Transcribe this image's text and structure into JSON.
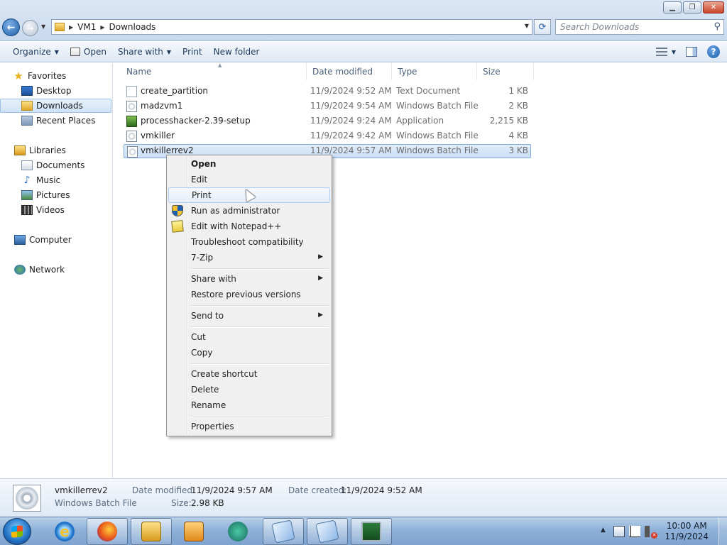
{
  "window": {
    "breadcrumb": [
      "VM1",
      "Downloads"
    ],
    "search_placeholder": "Search Downloads"
  },
  "toolbar": {
    "organize": "Organize",
    "open": "Open",
    "share_with": "Share with",
    "print": "Print",
    "new_folder": "New folder"
  },
  "sidebar": {
    "favorites": "Favorites",
    "desktop": "Desktop",
    "downloads": "Downloads",
    "recent_places": "Recent Places",
    "libraries": "Libraries",
    "documents": "Documents",
    "music": "Music",
    "pictures": "Pictures",
    "videos": "Videos",
    "computer": "Computer",
    "network": "Network"
  },
  "columns": {
    "name": "Name",
    "date_modified": "Date modified",
    "type": "Type",
    "size": "Size"
  },
  "files": [
    {
      "name": "create_partition",
      "date": "11/9/2024 9:52 AM",
      "type": "Text Document",
      "size": "1 KB",
      "icon": "text-file-icon"
    },
    {
      "name": "madzvm1",
      "date": "11/9/2024 9:54 AM",
      "type": "Windows Batch File",
      "size": "2 KB",
      "icon": "batch-file-icon"
    },
    {
      "name": "processhacker-2.39-setup",
      "date": "11/9/2024 9:24 AM",
      "type": "Application",
      "size": "2,215 KB",
      "icon": "application-icon"
    },
    {
      "name": "vmkiller",
      "date": "11/9/2024 9:42 AM",
      "type": "Windows Batch File",
      "size": "4 KB",
      "icon": "batch-file-icon"
    },
    {
      "name": "vmkillerrev2",
      "date": "11/9/2024 9:57 AM",
      "type": "Windows Batch File",
      "size": "3 KB",
      "icon": "batch-file-icon"
    }
  ],
  "context_menu": {
    "open": "Open",
    "edit": "Edit",
    "print": "Print",
    "run_as_admin": "Run as administrator",
    "edit_notepadpp": "Edit with Notepad++",
    "troubleshoot": "Troubleshoot compatibility",
    "seven_zip": "7-Zip",
    "share_with": "Share with",
    "restore_versions": "Restore previous versions",
    "send_to": "Send to",
    "cut": "Cut",
    "copy": "Copy",
    "create_shortcut": "Create shortcut",
    "delete": "Delete",
    "rename": "Rename",
    "properties": "Properties"
  },
  "details": {
    "name": "vmkillerrev2",
    "type": "Windows Batch File",
    "date_modified_label": "Date modified:",
    "date_modified": "11/9/2024 9:57 AM",
    "date_created_label": "Date created:",
    "date_created": "11/9/2024 9:52 AM",
    "size_label": "Size:",
    "size": "2.98 KB"
  },
  "taskbar": {
    "time": "10:00 AM",
    "date": "11/9/2024"
  },
  "colors": {
    "selection": "#cadff6",
    "accent": "#1c5ea6"
  }
}
